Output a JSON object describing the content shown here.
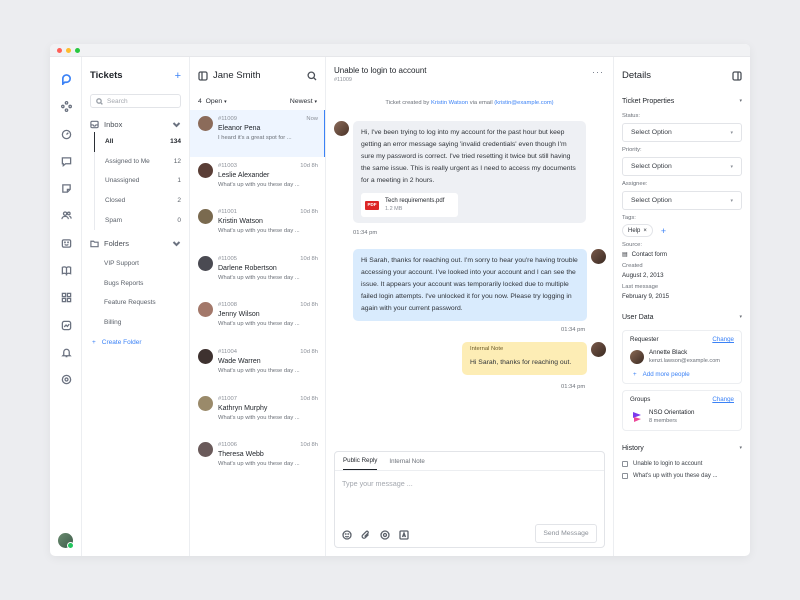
{
  "window": {
    "dot_colors": [
      "#ff5f57",
      "#febc2e",
      "#28c840"
    ]
  },
  "rail": {
    "icons": [
      "logo-icon",
      "workflow-icon",
      "dashboard-icon",
      "chat-icon",
      "notes-icon",
      "contacts-icon",
      "bot-icon",
      "knowledge-icon",
      "apps-icon",
      "analytics-icon",
      "notifications-icon",
      "settings-icon"
    ]
  },
  "nav": {
    "title": "Tickets",
    "add": "+",
    "search_placeholder": "Search",
    "inbox_label": "Inbox",
    "inbox_items": [
      {
        "label": "All",
        "count": "134"
      },
      {
        "label": "Assigned to Me",
        "count": "12"
      },
      {
        "label": "Unassigned",
        "count": "1"
      },
      {
        "label": "Closed",
        "count": "2"
      },
      {
        "label": "Spam",
        "count": "0"
      }
    ],
    "folders_label": "Folders",
    "folder_items": [
      "VIP Support",
      "Bugs Reports",
      "Feature Requests",
      "Billing"
    ],
    "create_folder": "Create Folder"
  },
  "list": {
    "contact_name": "Jane Smith",
    "open_count": "4",
    "open_label": "Open",
    "sort_label": "Newest",
    "tickets": [
      {
        "id": "#11009",
        "time": "Now",
        "name": "Eleanor Pena",
        "preview": "I heard it's a great spot for ...",
        "color": "#8b6b5a"
      },
      {
        "id": "#11003",
        "time": "10d 8h",
        "name": "Leslie Alexander",
        "preview": "What's up with you these day ...",
        "color": "#5a3e36"
      },
      {
        "id": "#11001",
        "time": "10d 8h",
        "name": "Kristin Watson",
        "preview": "What's up with you these day ...",
        "color": "#7a6a4f"
      },
      {
        "id": "#11005",
        "time": "10d 8h",
        "name": "Darlene Robertson",
        "preview": "What's up with you these day ...",
        "color": "#4a4a52"
      },
      {
        "id": "#11008",
        "time": "10d 8h",
        "name": "Jenny Wilson",
        "preview": "What's up with you these day ...",
        "color": "#a3786a"
      },
      {
        "id": "#11004",
        "time": "10d 8h",
        "name": "Wade Warren",
        "preview": "What's up with you these day ...",
        "color": "#3e3230"
      },
      {
        "id": "#11007",
        "time": "10d 8h",
        "name": "Kathryn Murphy",
        "preview": "What's up with you these day ...",
        "color": "#9a8a6a"
      },
      {
        "id": "#11006",
        "time": "10d 8h",
        "name": "Theresa Webb",
        "preview": "What's up with you these day ...",
        "color": "#6a5a5a"
      }
    ]
  },
  "conversation": {
    "title": "Unable to login to account",
    "ticket_id": "#11009",
    "created_prefix": "Ticket created by",
    "created_by": "Kristin Watson",
    "created_mid": "via email",
    "created_email": "(kristin@example.com)",
    "msg1": "Hi, I've been trying to log into my account for the past hour but keep getting an error message saying 'invalid credentials' even though I'm sure my password is correct. I've tried resetting it twice but still having the same issue. This is really urgent as I need to access my documents for a meeting in 2 hours.",
    "attachment_name": "Tech requirements.pdf",
    "attachment_size": "1.2 MB",
    "pdf_badge": "PDF",
    "time1": "01:34 pm",
    "msg2": "Hi Sarah, thanks for reaching out. I'm sorry to hear you're having trouble accessing your account. I've looked into your account and I can see the issue. It appears your account was temporarily locked due to multiple failed login attempts. I've unlocked it for you now. Please try logging in again with your current password.",
    "time2": "01:34 pm",
    "note_label": "Internal Note",
    "note_text": "Hi Sarah, thanks for reaching out.",
    "time3": "01:34 pm",
    "bubble_colors": {
      "incoming": "#eef0f4",
      "outgoing": "#d9ebfd",
      "note": "#fdedb5"
    },
    "reply_tab_public": "Public Reply",
    "reply_tab_internal": "Internal Note",
    "reply_placeholder": "Type your message ...",
    "send_label": "Send Message"
  },
  "details": {
    "title": "Details",
    "props_label": "Ticket Properties",
    "status_label": "Status:",
    "priority_label": "Priority:",
    "assignee_label": "Assignee:",
    "select_placeholder": "Select Option",
    "tags_label": "Tags:",
    "tag": "Help",
    "source_label": "Source:",
    "source_value": "Contact form",
    "created_label": "Created",
    "created_value": "August 2, 2013",
    "last_label": "Last message",
    "last_value": "February 9, 2015",
    "user_data_label": "User Data",
    "requester_label": "Requester",
    "change_label": "Change",
    "requester_name": "Annette Black",
    "requester_email": "kenzi.lawson@example.com",
    "add_people": "Add more people",
    "groups_label": "Groups",
    "group_name": "NSO Orientation",
    "group_members": "8 members",
    "history_label": "History",
    "history_items": [
      "Unable to login to account",
      "What's up with you these day ..."
    ]
  }
}
